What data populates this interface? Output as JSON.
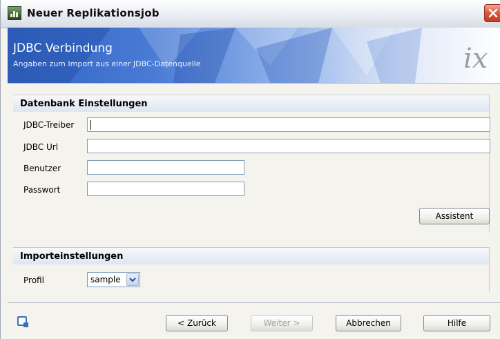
{
  "window": {
    "title": "Neuer Replikationsjob",
    "close_icon": "close-icon",
    "app_icon": "chart-window-icon"
  },
  "banner": {
    "title": "JDBC Verbindung",
    "subtitle": "Angaben zum Import aus einer JDBC-Datenquelle",
    "logo": "ix"
  },
  "db_settings": {
    "title": "Datenbank Einstellungen",
    "driver_label": "JDBC-Treiber",
    "driver_value": "",
    "url_label": "JDBC Url",
    "url_value": "",
    "user_label": "Benutzer",
    "user_value": "",
    "password_label": "Passwort",
    "password_value": "",
    "assistant_button": "Assistent"
  },
  "import_settings": {
    "title": "Importeinstellungen",
    "profile_label": "Profil",
    "profile_value": "sample"
  },
  "footer": {
    "back_button": "< Zurück",
    "next_button": "Weiter >",
    "cancel_button": "Abbrechen",
    "help_button": "Hilfe"
  },
  "colors": {
    "banner_blue": "#2f61c2",
    "close_red": "#d9553e",
    "field_border": "#7f9db9"
  }
}
